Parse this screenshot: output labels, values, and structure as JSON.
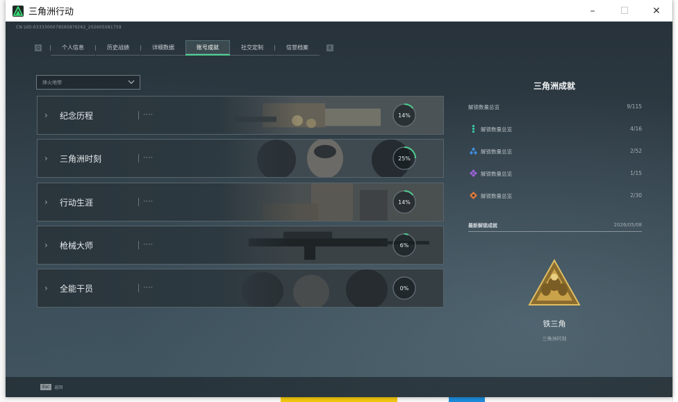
{
  "window": {
    "title": "三角洲行动",
    "controls": {
      "minimize": "–",
      "maximize": "☐",
      "close": "✕"
    }
  },
  "build_id": "CN UID:63333000785658?9262_202605081759",
  "tabs": [
    {
      "label": "个人信息",
      "active": false
    },
    {
      "label": "历史战绩",
      "active": false
    },
    {
      "label": "详细数据",
      "active": false
    },
    {
      "label": "账号成就",
      "active": true
    },
    {
      "label": "社交定制",
      "active": false
    },
    {
      "label": "信誉档案",
      "active": false
    }
  ],
  "tab_nav": {
    "prev": "Q",
    "next": "E"
  },
  "filter": {
    "value": "烽火地带"
  },
  "categories": [
    {
      "label": "纪念历程",
      "percent": 14,
      "percent_text": "14%"
    },
    {
      "label": "三角洲时刻",
      "percent": 25,
      "percent_text": "25%"
    },
    {
      "label": "行动生涯",
      "percent": 14,
      "percent_text": "14%"
    },
    {
      "label": "枪械大师",
      "percent": 6,
      "percent_text": "6%"
    },
    {
      "label": "全能干员",
      "percent": 0,
      "percent_text": "0%"
    }
  ],
  "panel": {
    "title": "三角洲成就",
    "total": {
      "label": "解锁数量总览",
      "value": "9/115"
    },
    "rows": [
      {
        "icon": "teal-rank-icon",
        "label": "解锁数量总览",
        "value": "4/16",
        "color": "#39c4a0"
      },
      {
        "icon": "blue-rank-icon",
        "label": "解锁数量总览",
        "value": "2/52",
        "color": "#3f8fe0"
      },
      {
        "icon": "purple-rank-icon",
        "label": "解锁数量总览",
        "value": "1/15",
        "color": "#9a62d8"
      },
      {
        "icon": "orange-rank-icon",
        "label": "解锁数量总览",
        "value": "2/30",
        "color": "#e07a3b"
      }
    ],
    "latest": {
      "label": "最新解锁成就",
      "date": "2026/05/08",
      "name": "铁三角",
      "category": "三角洲时刻"
    }
  },
  "bottom": {
    "key": "Esc",
    "action": "返回"
  },
  "colors": {
    "accent": "#4fd08f",
    "badge_gold": "#c9a24a"
  }
}
